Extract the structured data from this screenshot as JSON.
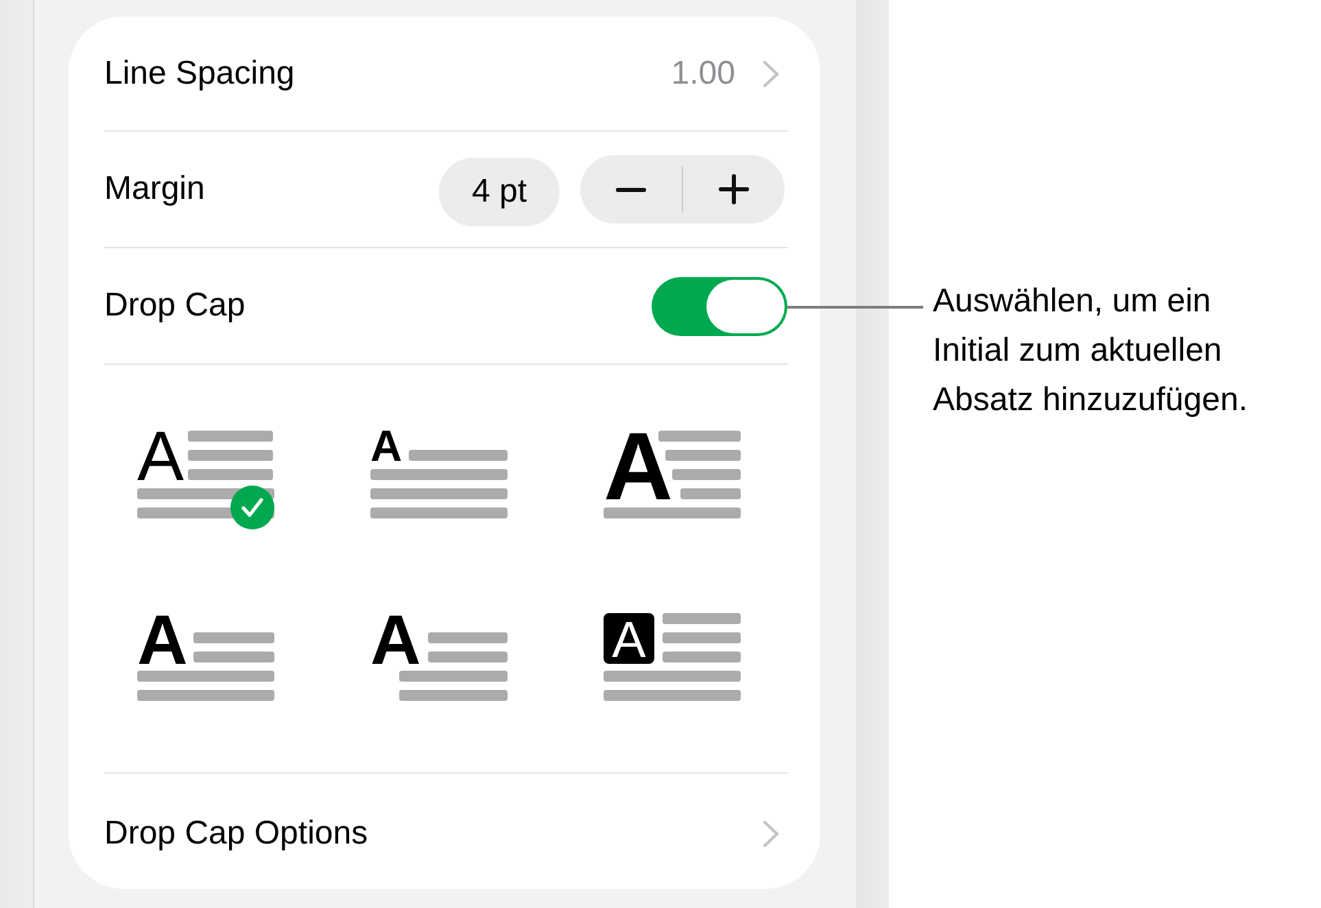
{
  "rows": [
    {
      "kind": "value",
      "label": "Line Spacing",
      "value": "1.00"
    },
    {
      "kind": "stepper",
      "label": "Margin",
      "value": "4 pt"
    },
    {
      "kind": "toggle",
      "label": "Drop Cap",
      "on": true
    }
  ],
  "drop_cap_styles": [
    {
      "kind": "thin",
      "letter": "A",
      "selected": true
    },
    {
      "kind": "raised",
      "letter": "A",
      "selected": false
    },
    {
      "kind": "large",
      "letter": "A",
      "selected": false
    },
    {
      "kind": "bold",
      "letter": "A",
      "selected": false
    },
    {
      "kind": "hanging",
      "letter": "A",
      "selected": false
    },
    {
      "kind": "boxed",
      "letter": "A",
      "selected": false
    }
  ],
  "options_row": {
    "label": "Drop Cap Options"
  },
  "callout": {
    "text": "Auswählen, um ein Initial zum aktuellen Absatz hinzuzufügen."
  }
}
